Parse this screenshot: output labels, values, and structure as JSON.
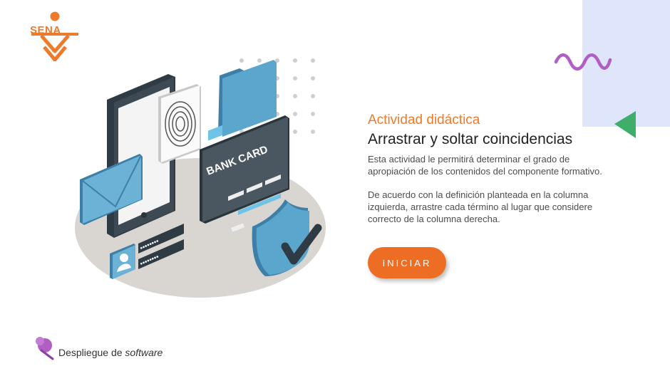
{
  "logo": {
    "text": "SENA",
    "color": "#ee7a2c"
  },
  "illustration": {
    "icon": "mobile-payment-security-illustration",
    "card_label": "BANK CARD",
    "password_mask_1": "••••••••",
    "password_mask_2": "••••••••"
  },
  "intro": {
    "eyebrow": "Actividad didáctica",
    "title": "Arrastrar y soltar coincidencias",
    "paragraph_1": "Esta actividad le permitirá determinar el grado de apropiación de los contenidos del componente formativo.",
    "paragraph_2": "De acuerdo con la definición planteada en la columna izquierda, arrastre cada término al lugar que considere correcto de la columna derecha."
  },
  "start_button": {
    "label": "INICIAR",
    "color": "#ee6d24"
  },
  "footer": {
    "prefix": "Despliegue de ",
    "emphasis": "software",
    "icon": "pushpin-icon"
  },
  "colors": {
    "accent_orange": "#ee7a2c",
    "deco_lavender": "#dfe6fb",
    "deco_wave": "#b05fc4",
    "deco_triangle": "#3fae6b",
    "illustration_blue": "#5aa6cc",
    "illustration_dark": "#3d4a54"
  }
}
